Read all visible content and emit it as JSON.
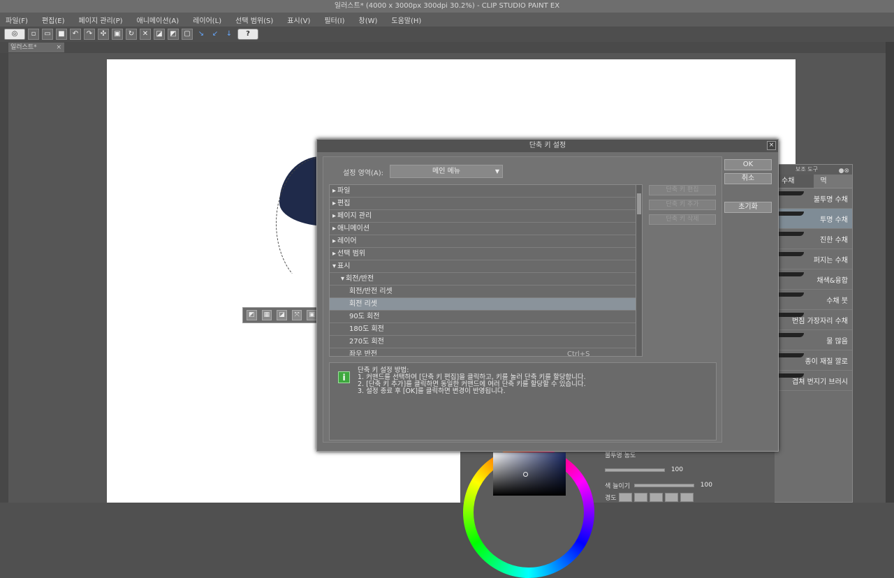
{
  "window": {
    "title": "일러스트* (4000 x 3000px 300dpi 30.2%)  - CLIP STUDIO PAINT EX"
  },
  "menu": [
    "파일(F)",
    "편집(E)",
    "페이지 관리(P)",
    "애니메이션(A)",
    "레이어(L)",
    "선택 범위(S)",
    "표시(V)",
    "필터(I)",
    "창(W)",
    "도움말(H)"
  ],
  "toolbar": {
    "logo": "◎",
    "help": "?",
    "icons": [
      "new-icon",
      "open-icon",
      "save-icon",
      "undo-icon",
      "redo-icon",
      "select-icon",
      "transform-icon",
      "rotate-icon",
      "fit-icon",
      "clear-icon",
      "fill-icon",
      "frame-icon",
      "ruler-icon",
      "pen-icon",
      "pen2-icon"
    ]
  },
  "tab": {
    "label": "일러스트*",
    "close": "×"
  },
  "float_toolbar": {
    "icons": [
      "◩",
      "▦",
      "◪",
      "⤧",
      "▣"
    ]
  },
  "dialog": {
    "title": "단축 키 설정",
    "close": "×",
    "area_label": "설정 영역(A):",
    "area_value": "메인 메뉴",
    "ok": "OK",
    "cancel": "취소",
    "reset": "초기화",
    "side_buttons": [
      "단축 키 편집",
      "단축 키 추가",
      "단축 키 삭제"
    ],
    "rows": [
      {
        "label": "파일",
        "indent": 0,
        "arrow": "▸",
        "shortcut": ""
      },
      {
        "label": "편집",
        "indent": 0,
        "arrow": "▸",
        "shortcut": ""
      },
      {
        "label": "페이지 관리",
        "indent": 0,
        "arrow": "▸",
        "shortcut": ""
      },
      {
        "label": "애니메이션",
        "indent": 0,
        "arrow": "▸",
        "shortcut": ""
      },
      {
        "label": "레이어",
        "indent": 0,
        "arrow": "▸",
        "shortcut": ""
      },
      {
        "label": "선택 범위",
        "indent": 0,
        "arrow": "▸",
        "shortcut": ""
      },
      {
        "label": "표시",
        "indent": 0,
        "arrow": "▾",
        "shortcut": ""
      },
      {
        "label": "회전/반전",
        "indent": 1,
        "arrow": "▾",
        "shortcut": ""
      },
      {
        "label": "회전/반전 리셋",
        "indent": 2,
        "arrow": "",
        "shortcut": ""
      },
      {
        "label": "회전 리셋",
        "indent": 2,
        "arrow": "",
        "shortcut": "",
        "selected": true
      },
      {
        "label": "90도 회전",
        "indent": 2,
        "arrow": "",
        "shortcut": ""
      },
      {
        "label": "180도 회전",
        "indent": 2,
        "arrow": "",
        "shortcut": ""
      },
      {
        "label": "270도 회전",
        "indent": 2,
        "arrow": "",
        "shortcut": ""
      },
      {
        "label": "좌우 반전",
        "indent": 2,
        "arrow": "",
        "shortcut": "Ctrl+S"
      }
    ],
    "info_icon": "i",
    "info_lines": [
      "단축 키 설정 방법:",
      "1. 커맨드를 선택하여 [단축 키 편집]을 클릭하고, 키를 눌러 단축 키를 할당합니다.",
      "2. [단축 키 추가]를 클릭하면 동일한 커맨드에 여러 단축 키를 할당할 수 있습니다.",
      "3. 설정 종료 후 [OK]를 클릭하면 변경이 반영됩니다."
    ]
  },
  "brush_panel": {
    "header": "보조 도구",
    "tabs": [
      "수채",
      "먹"
    ],
    "items": [
      {
        "label": "불투명 수채"
      },
      {
        "label": "투명 수채",
        "selected": true
      },
      {
        "label": "진한 수채"
      },
      {
        "label": "퍼지는 수채"
      },
      {
        "label": "채색&융합"
      },
      {
        "label": "수채 붓"
      },
      {
        "label": "번짐 가장자리 수채"
      },
      {
        "label": "물 많음"
      },
      {
        "label": "종이 재질 깔로"
      },
      {
        "label": "겹쳐 번지기 브러시"
      }
    ]
  },
  "color_panel": {
    "opacity_label": "불투명 농도",
    "opacity_value": "100",
    "lift_label": "색 늘이기",
    "lift_value": "100",
    "mix_label": "경도"
  }
}
